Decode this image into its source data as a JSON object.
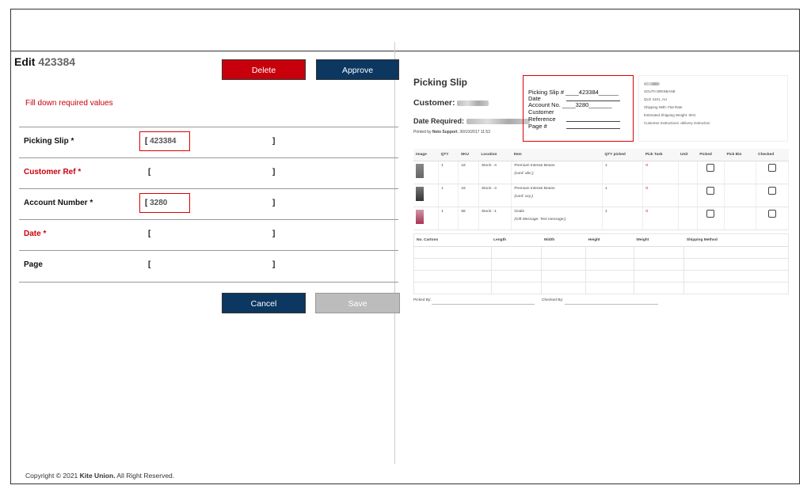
{
  "form": {
    "title_prefix": "Edit",
    "title_number": "423384",
    "delete_label": "Delete",
    "approve_label": "Approve",
    "required_msg": "Fill down required values",
    "cancel_label": "Cancel",
    "save_label": "Save",
    "rows": [
      {
        "label": "Picking Slip *",
        "value": "423384",
        "required": false
      },
      {
        "label": "Customer Ref *",
        "value": "",
        "required": true
      },
      {
        "label": "Account Number *",
        "value": "3280",
        "required": false
      },
      {
        "label": "Date *",
        "value": "",
        "required": true
      },
      {
        "label": "Page",
        "value": "",
        "required": false
      }
    ],
    "open_bracket": "[",
    "close_bracket": "]"
  },
  "slip": {
    "title": "Picking Slip",
    "customer_label": "Customer:",
    "date_label": "Date Required:",
    "printed_by": "Printed by",
    "printed_name": "Neto Support",
    "printed_date": ", 30/10/2017 11:53",
    "box": {
      "picking_slip": "Picking Slip # ____423384______",
      "date": "Date",
      "account": "Account No.   ____3280_______",
      "customer": "Customer",
      "reference": "Reference",
      "page": "Page #"
    },
    "address": {
      "line1": "SOUTH BRISBANE",
      "line2": "QLD 4101, AU",
      "line3": "Shipping With: Flat Rate",
      "line4": "Estimated Shipping Weight: 0KG",
      "line5": "Customer Instructions: delivery instruction"
    },
    "headers": [
      "Image",
      "QTY",
      "SKU",
      "Location",
      "Item",
      "QTY picked",
      "Pick Task",
      "Unit",
      "Picked",
      "Pick Bin",
      "Checked"
    ],
    "items": [
      {
        "qty": "1",
        "sku": "18",
        "location": "Stock: -4",
        "item": "Premium Intense Beans",
        "note": "(card: abc;)",
        "qty_picked": "1",
        "pick_task": "0"
      },
      {
        "qty": "1",
        "sku": "18",
        "location": "Stock: -4",
        "item": "Premium Intense Beans",
        "note": "(card: xxy;)",
        "qty_picked": "1",
        "pick_task": "0"
      },
      {
        "qty": "1",
        "sku": "58",
        "location": "Stock: -1",
        "item": "Goals",
        "note": "(Gift Message: Test message;)",
        "qty_picked": "1",
        "pick_task": "0"
      }
    ],
    "carton_headers": [
      "No. Cartons",
      "Length",
      "Width",
      "Height",
      "Weight",
      "Shipping Method"
    ],
    "picked_by": "Picked By:",
    "checked_by": "Checked By:"
  },
  "footer": {
    "prefix": "Copyright © 2021 ",
    "brand": "Kite Union.",
    "suffix": " All Right Reserved."
  }
}
